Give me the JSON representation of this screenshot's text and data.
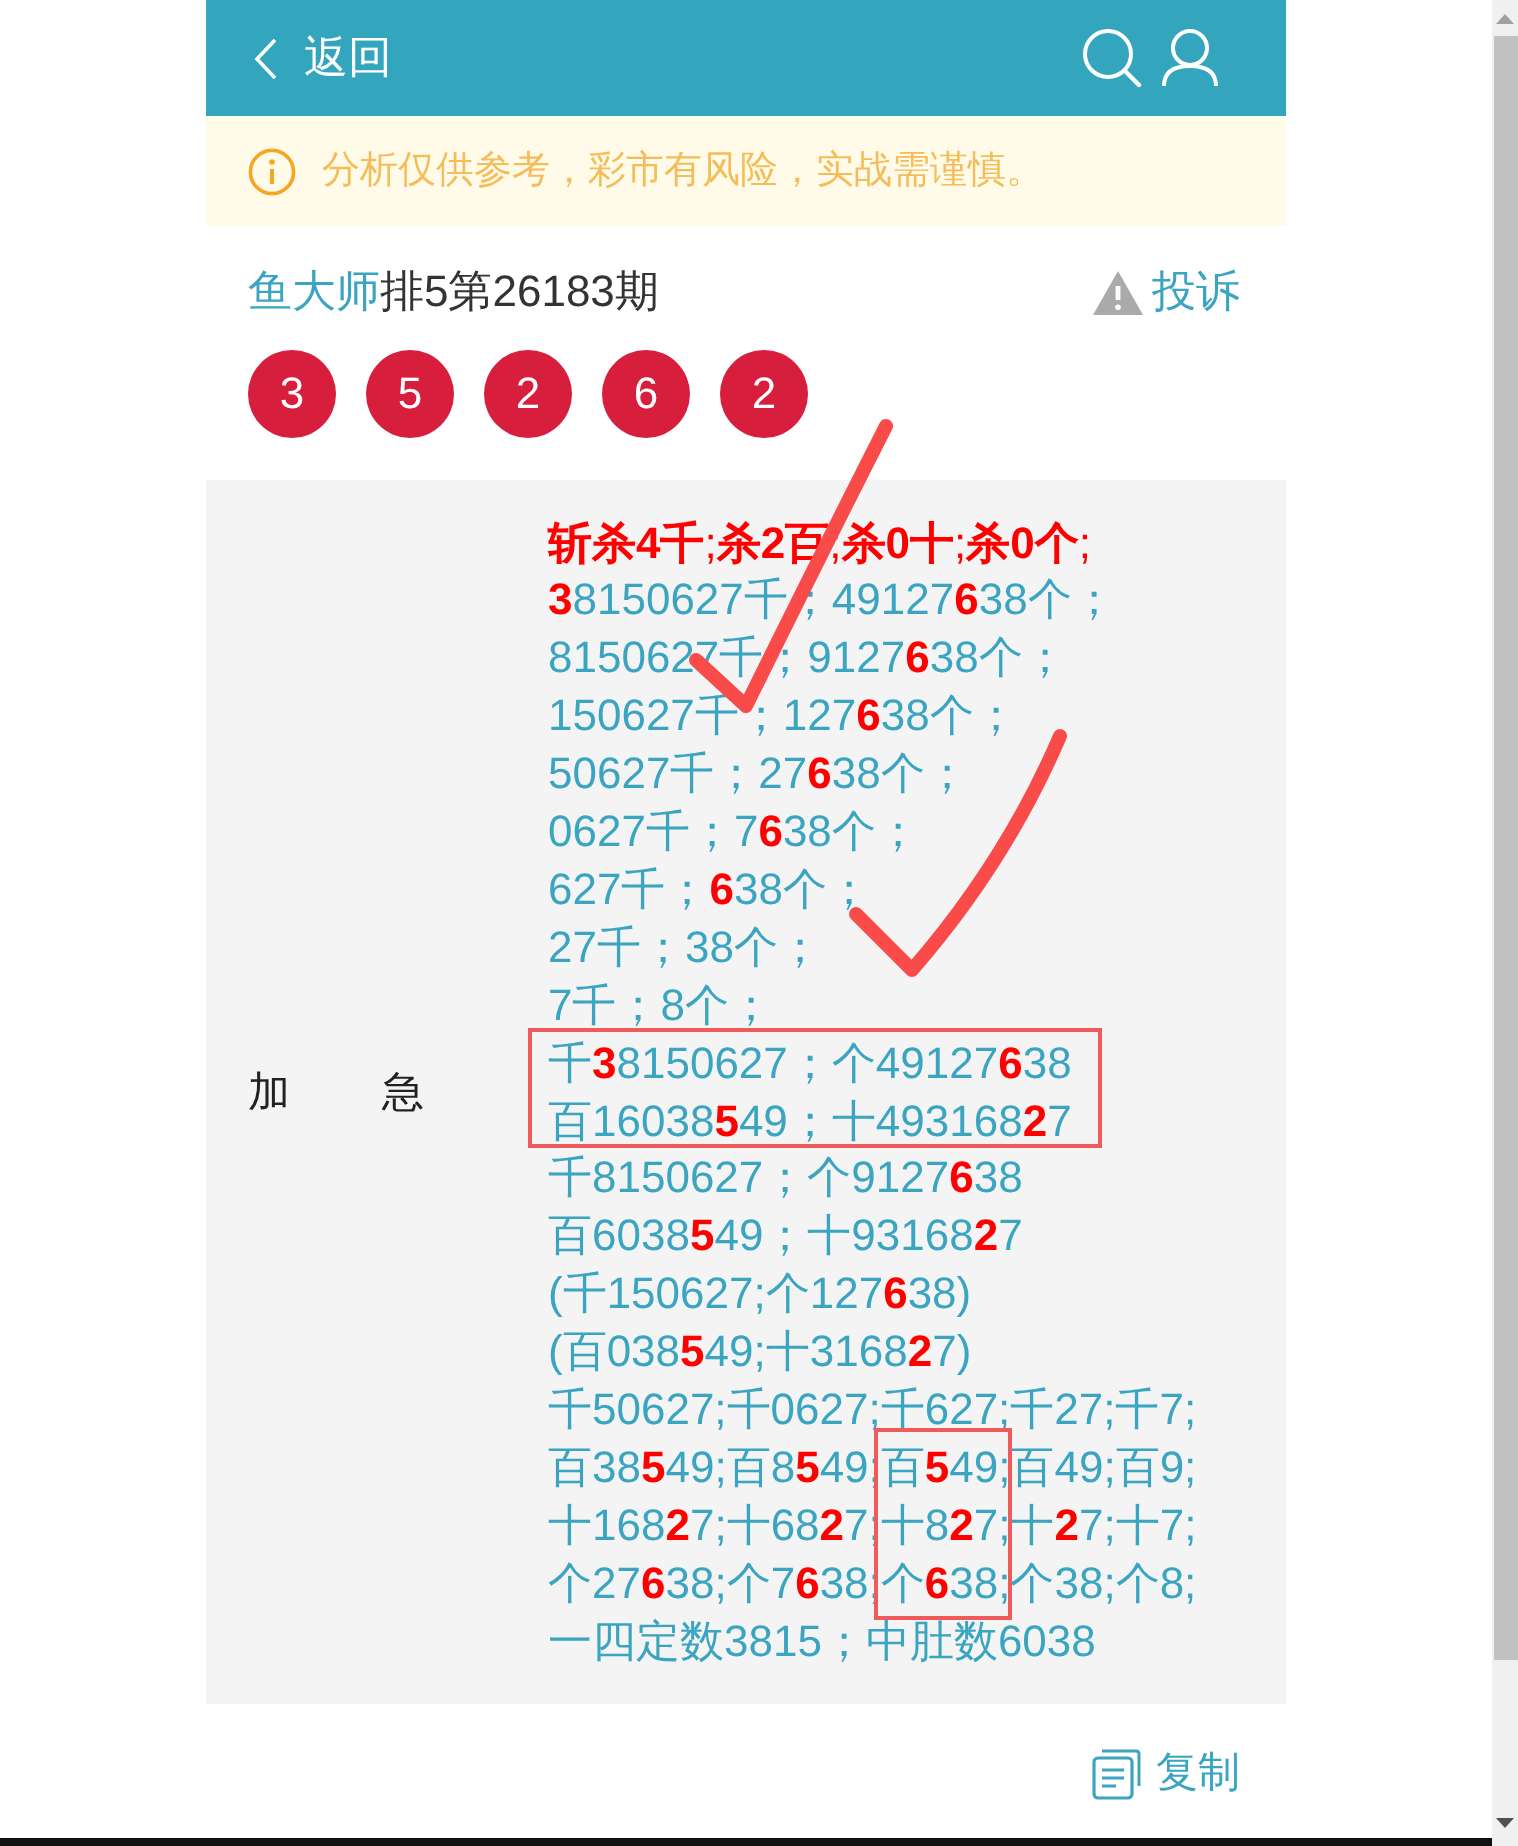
{
  "header": {
    "back_label": "返回"
  },
  "notice": {
    "text": "分析仅供参考，彩市有风险，实战需谨慎。"
  },
  "title": {
    "author": "鱼大师",
    "issue": "排5第26183期",
    "report_label": "投诉"
  },
  "draw_numbers": [
    "3",
    "5",
    "2",
    "6",
    "2"
  ],
  "analysis": {
    "label": "加急",
    "lines": [
      {
        "kind": "kill",
        "text": "**斩杀4千**;**杀2百**;**杀0十**;**杀0个**;"
      },
      {
        "kind": "plain",
        "text": "**3**8150627千；49127**6**38个；"
      },
      {
        "kind": "plain",
        "text": "8150627千；9127**6**38个；"
      },
      {
        "kind": "plain",
        "text": "150627千；127**6**38个；"
      },
      {
        "kind": "plain",
        "text": "50627千；27**6**38个；"
      },
      {
        "kind": "plain",
        "text": "0627千；7**6**38个；"
      },
      {
        "kind": "plain",
        "text": "627千；**6**38个；"
      },
      {
        "kind": "plain",
        "text": "27千；38个；"
      },
      {
        "kind": "plain",
        "text": "7千；8个；"
      },
      {
        "kind": "plain",
        "text": "千**3**8150627；个49127**6**38"
      },
      {
        "kind": "plain",
        "text": "百16038**5**49；十493168**2**7"
      },
      {
        "kind": "plain",
        "text": "千8150627；个9127**6**38"
      },
      {
        "kind": "plain",
        "text": "百6038**5**49；十93168**2**7"
      },
      {
        "kind": "plain",
        "text": "(千150627;个127**6**38)"
      },
      {
        "kind": "plain",
        "text": "(百038**5**49;十3168**2**7)"
      },
      {
        "kind": "plain",
        "text": "千50627;千0627;千627;千27;千7;"
      },
      {
        "kind": "plain",
        "text": "百38**5**49;百8**5**49;百**5**49;百49;百9;"
      },
      {
        "kind": "plain",
        "text": "十168**2**7;十68**2**7;十8**2**7;十**2**7;十7;"
      },
      {
        "kind": "plain",
        "text": "个27**6**38;个7**6**38;个**6**38;个38;个8;"
      },
      {
        "kind": "plain",
        "text": "一四定数3815；中肚数6038"
      }
    ]
  },
  "copy_label": "复制"
}
